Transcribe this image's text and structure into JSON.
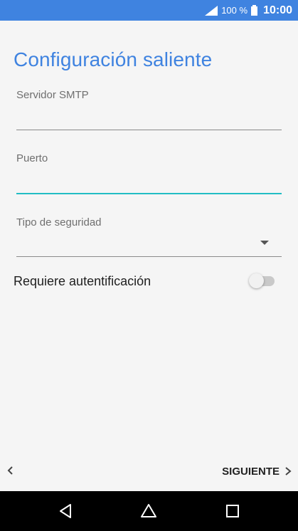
{
  "status_bar": {
    "battery_percent": "100 %",
    "time": "10:00",
    "icons": [
      "signal-icon",
      "battery-icon"
    ]
  },
  "page": {
    "title": "Configuración saliente"
  },
  "form": {
    "smtp_server": {
      "label": "Servidor SMTP",
      "value": ""
    },
    "port": {
      "label": "Puerto",
      "value": ""
    },
    "security_type": {
      "label": "Tipo de seguridad",
      "value": ""
    },
    "auth_required": {
      "label": "Requiere autentificación",
      "on": false
    }
  },
  "footer": {
    "next_label": "SIGUIENTE"
  },
  "nav_bar": {
    "icons": [
      "back-triangle-icon",
      "home-icon",
      "recents-icon"
    ]
  },
  "colors": {
    "accent": "#3f83e0",
    "focus": "#22bdc4"
  }
}
